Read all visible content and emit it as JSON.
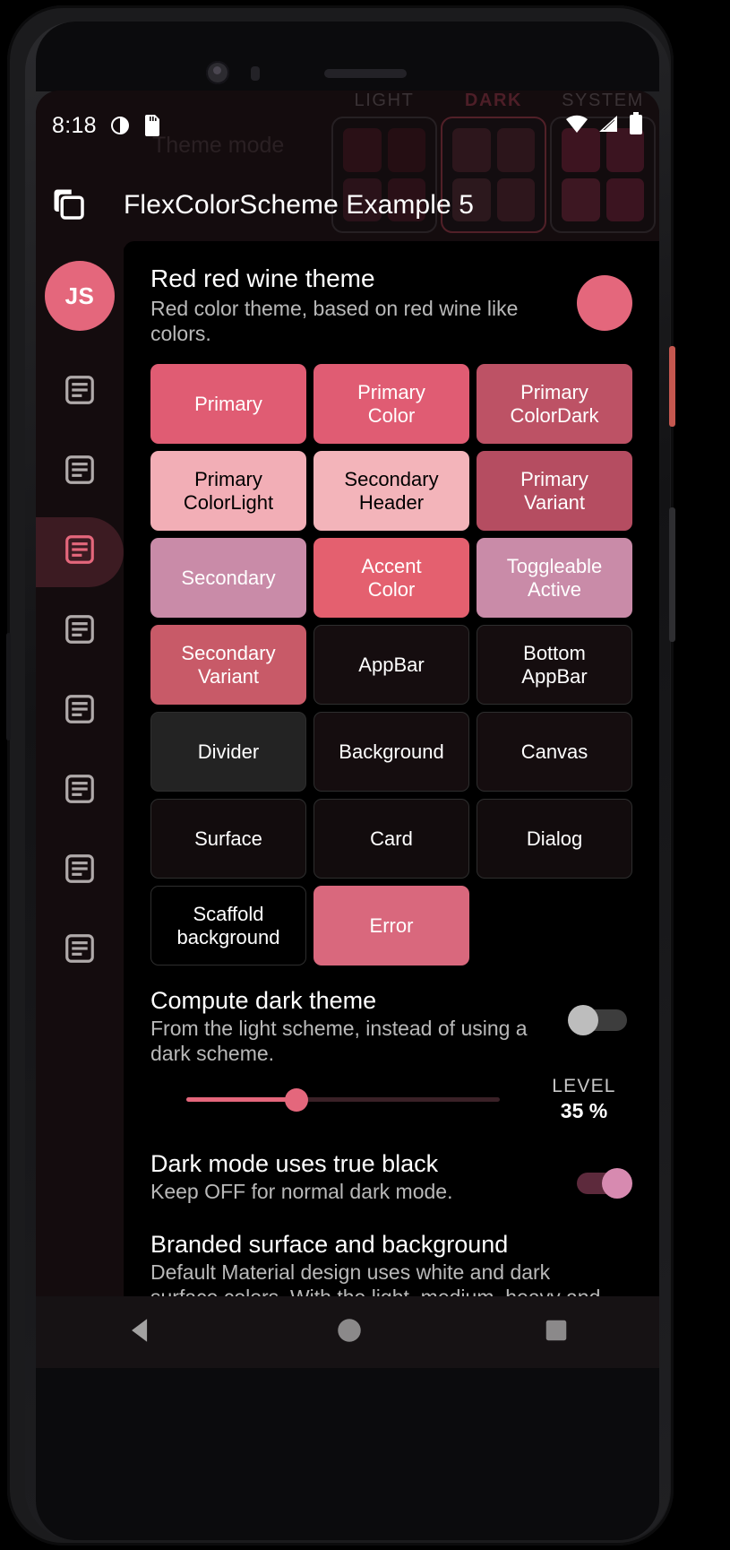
{
  "status_bar": {
    "time": "8:18",
    "icons": [
      "brightness-icon",
      "sd-card-icon",
      "wifi-icon",
      "signal-icon",
      "battery-icon"
    ]
  },
  "app_bar": {
    "menu_icon": "copy-pages-icon",
    "title": "FlexColorScheme Example 5"
  },
  "theme_mode_backdrop": {
    "title": "Theme mode",
    "options": [
      {
        "label": "LIGHT",
        "selected": false
      },
      {
        "label": "DARK",
        "selected": true
      },
      {
        "label": "SYSTEM",
        "selected": false
      }
    ]
  },
  "nav_rail": {
    "avatar_initials": "JS",
    "items": [
      {
        "name": "sidebar-item-1",
        "icon": "article-icon",
        "selected": false
      },
      {
        "name": "sidebar-item-2",
        "icon": "article-icon",
        "selected": false
      },
      {
        "name": "sidebar-item-3",
        "icon": "article-icon",
        "selected": true
      },
      {
        "name": "sidebar-item-4",
        "icon": "article-icon",
        "selected": false
      },
      {
        "name": "sidebar-item-5",
        "icon": "article-icon",
        "selected": false
      },
      {
        "name": "sidebar-item-6",
        "icon": "article-icon",
        "selected": false
      },
      {
        "name": "sidebar-item-7",
        "icon": "article-icon",
        "selected": false
      },
      {
        "name": "sidebar-item-8",
        "icon": "article-icon",
        "selected": false
      }
    ]
  },
  "scheme": {
    "title": "Red red wine theme",
    "subtitle": "Red color theme, based on red wine like colors.",
    "swatch_color": "#E4677C"
  },
  "color_cards": [
    {
      "label": "Primary",
      "bg": "#E05C73",
      "fg": "#ffffff",
      "border": false
    },
    {
      "label": "Primary\nColor",
      "bg": "#E05C73",
      "fg": "#ffffff",
      "border": false
    },
    {
      "label": "Primary\nColorDark",
      "bg": "#BD5265",
      "fg": "#ffffff",
      "border": false
    },
    {
      "label": "Primary\nColorLight",
      "bg": "#F2AEB6",
      "fg": "#000000",
      "border": false
    },
    {
      "label": "Secondary\nHeader",
      "bg": "#F3B4BA",
      "fg": "#000000",
      "border": false
    },
    {
      "label": "Primary\nVariant",
      "bg": "#B54D61",
      "fg": "#ffffff",
      "border": false
    },
    {
      "label": "Secondary",
      "bg": "#C98BA8",
      "fg": "#ffffff",
      "border": false
    },
    {
      "label": "Accent\nColor",
      "bg": "#E4606F",
      "fg": "#ffffff",
      "border": false
    },
    {
      "label": "Toggleable\nActive",
      "bg": "#C98BA8",
      "fg": "#ffffff",
      "border": false
    },
    {
      "label": "Secondary\nVariant",
      "bg": "#C85A68",
      "fg": "#ffffff",
      "border": false
    },
    {
      "label": "AppBar",
      "bg": "#150D0F",
      "fg": "#ffffff",
      "border": true
    },
    {
      "label": "Bottom\nAppBar",
      "bg": "#150D0F",
      "fg": "#ffffff",
      "border": true
    },
    {
      "label": "Divider",
      "bg": "#232323",
      "fg": "#ffffff",
      "border": true
    },
    {
      "label": "Background",
      "bg": "#150D0F",
      "fg": "#ffffff",
      "border": true
    },
    {
      "label": "Canvas",
      "bg": "#150D0F",
      "fg": "#ffffff",
      "border": true
    },
    {
      "label": "Surface",
      "bg": "#120C0D",
      "fg": "#ffffff",
      "border": true
    },
    {
      "label": "Card",
      "bg": "#120C0D",
      "fg": "#ffffff",
      "border": true
    },
    {
      "label": "Dialog",
      "bg": "#120C0D",
      "fg": "#ffffff",
      "border": true
    },
    {
      "label": "Scaffold\nbackground",
      "bg": "#000000",
      "fg": "#ffffff",
      "border": true
    },
    {
      "label": "Error",
      "bg": "#D9687D",
      "fg": "#ffffff",
      "border": false
    }
  ],
  "settings": {
    "compute_dark": {
      "title": "Compute dark theme",
      "subtitle": "From the light scheme, instead of using a dark scheme.",
      "switch_on": false
    },
    "level": {
      "label": "LEVEL",
      "value": "35 %",
      "percent": 35
    },
    "true_black": {
      "title": "Dark mode uses true black",
      "subtitle": "Keep OFF for normal dark mode.",
      "switch_on": true
    },
    "branded": {
      "title": "Branded surface and background",
      "subtitle": "Default Material design uses white and dark surface colors. With the light, medium, heavy and strong branding, you can blend primary"
    }
  },
  "system_nav": {
    "back": "back-triangle-icon",
    "home": "home-circle-icon",
    "recents": "recents-square-icon"
  }
}
